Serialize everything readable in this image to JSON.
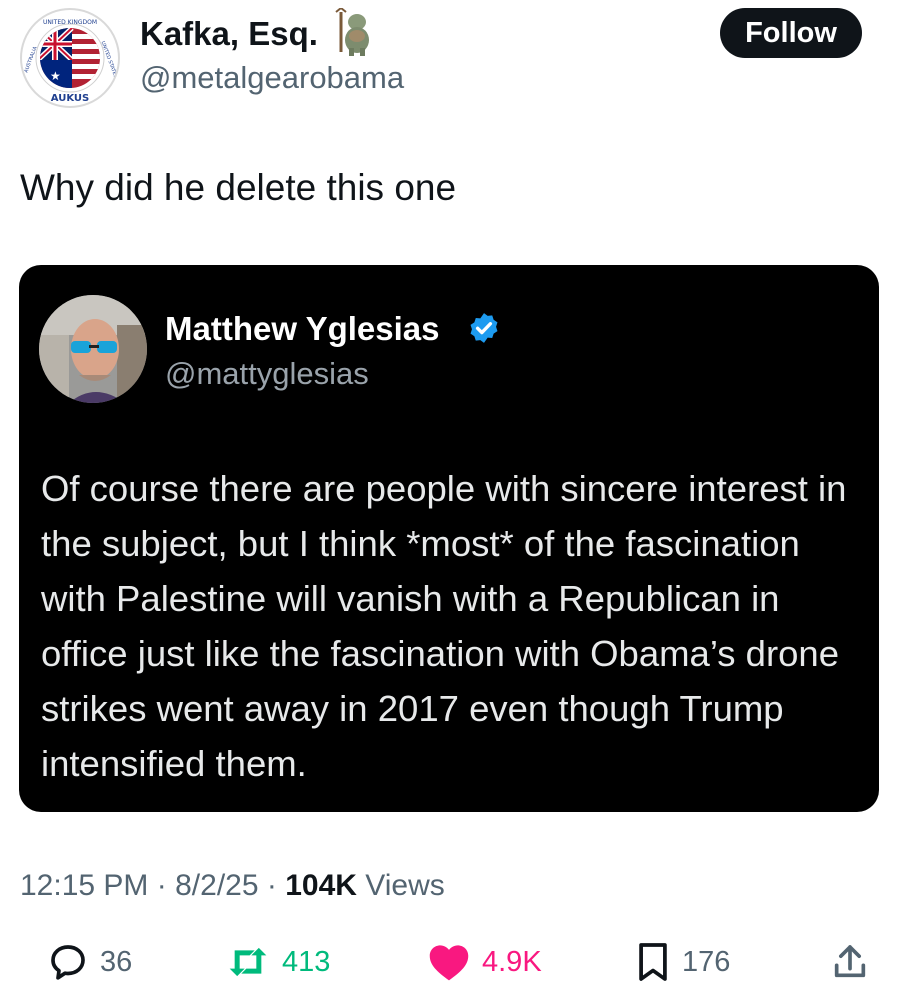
{
  "author": {
    "display_name": "Kafka, Esq.",
    "handle": "@metalgearobama",
    "avatar_label_top": "UNITED KINGDOM",
    "avatar_label_left": "AUSTRALIA",
    "avatar_label_right": "UNITED STATES",
    "avatar_label_bottom": "AUKUS"
  },
  "follow_button": {
    "label": "Follow"
  },
  "tweet": {
    "text": "Why did he delete this one"
  },
  "quoted_tweet": {
    "display_name": "Matthew Yglesias",
    "handle": "@mattyglesias",
    "verified": true,
    "body": "Of course there are people with sincere interest in the subject, but I think *most* of the fascination with Palestine will vanish with a Republican in office just like the fascination with Obama’s drone strikes went away in 2017 even though Trump intensified them."
  },
  "meta": {
    "time": "12:15 PM",
    "sep1": "·",
    "date": "8/2/25",
    "sep2": "·",
    "views_count": "104K",
    "views_label": "Views"
  },
  "actions": {
    "replies": "36",
    "reposts": "413",
    "likes": "4.9K",
    "bookmarks": "176"
  },
  "colors": {
    "text": "#0f1419",
    "secondary": "#536471",
    "retweet": "#00ba7c",
    "like": "#f91880",
    "verified": "#1d9bf0",
    "card_bg": "#000000"
  },
  "icons": [
    "aukus-avatar-icon",
    "troll-emoji-icon",
    "verified-badge-icon",
    "reply-icon",
    "retweet-icon",
    "heart-icon",
    "bookmark-icon",
    "share-icon"
  ]
}
